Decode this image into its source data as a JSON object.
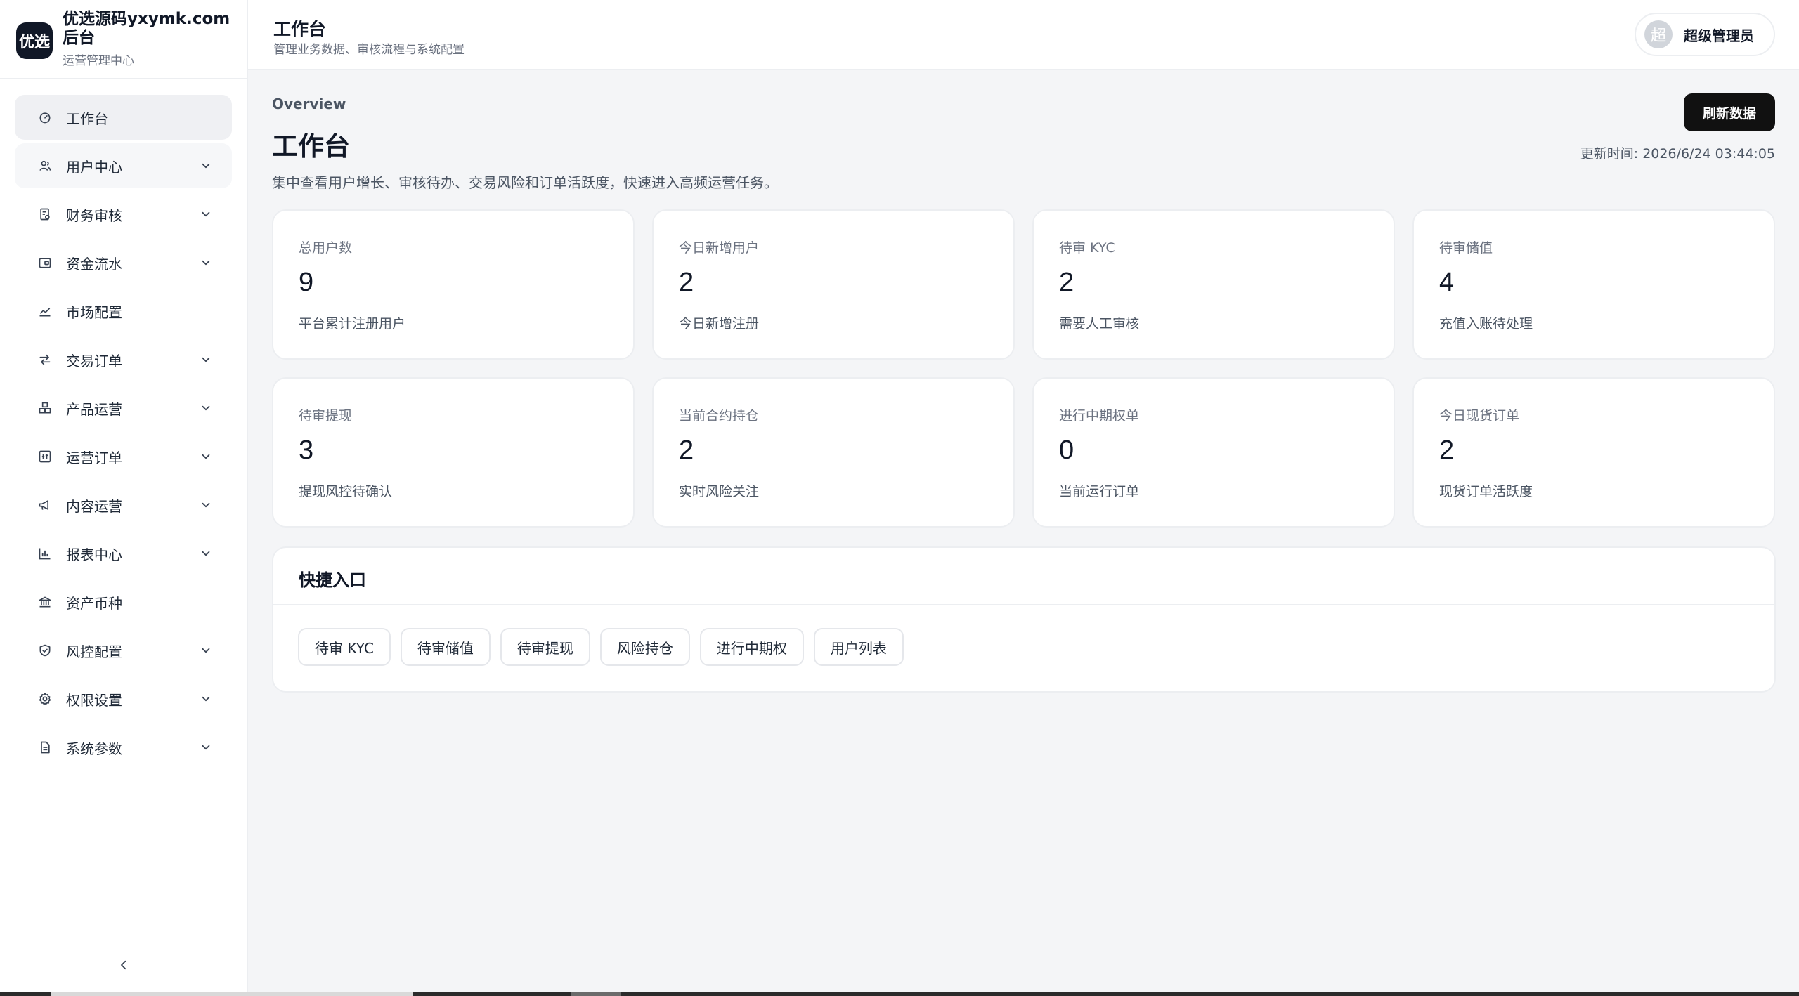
{
  "brand": {
    "logo": "优选",
    "title": "优选源码yxymk.com后台",
    "subtitle": "运营管理中心"
  },
  "sidebar": {
    "items": [
      {
        "label": "工作台",
        "icon": "dashboard-icon",
        "expandable": false,
        "active": true
      },
      {
        "label": "用户中心",
        "icon": "users-icon",
        "expandable": true,
        "active": false
      },
      {
        "label": "财务审核",
        "icon": "finance-audit-icon",
        "expandable": true,
        "active": false
      },
      {
        "label": "资金流水",
        "icon": "wallet-icon",
        "expandable": true,
        "active": false
      },
      {
        "label": "市场配置",
        "icon": "chart-line-icon",
        "expandable": false,
        "active": false
      },
      {
        "label": "交易订单",
        "icon": "exchange-icon",
        "expandable": true,
        "active": false
      },
      {
        "label": "产品运营",
        "icon": "boxes-icon",
        "expandable": true,
        "active": false
      },
      {
        "label": "运营订单",
        "icon": "grid-box-icon",
        "expandable": true,
        "active": false
      },
      {
        "label": "内容运营",
        "icon": "megaphone-icon",
        "expandable": true,
        "active": false
      },
      {
        "label": "报表中心",
        "icon": "bar-chart-icon",
        "expandable": true,
        "active": false
      },
      {
        "label": "资产币种",
        "icon": "bank-icon",
        "expandable": false,
        "active": false
      },
      {
        "label": "风控配置",
        "icon": "shield-icon",
        "expandable": true,
        "active": false
      },
      {
        "label": "权限设置",
        "icon": "gear-icon",
        "expandable": true,
        "active": false
      },
      {
        "label": "系统参数",
        "icon": "document-icon",
        "expandable": true,
        "active": false
      }
    ],
    "collapse_icon": "chevron-left-icon"
  },
  "topbar": {
    "title": "工作台",
    "subtitle": "管理业务数据、审核流程与系统配置",
    "user": {
      "avatar_text": "超",
      "name": "超级管理员"
    }
  },
  "main": {
    "overline": "Overview",
    "title": "工作台",
    "description": "集中查看用户增长、审核待办、交易风险和订单活跃度，快速进入高频运营任务。",
    "refresh_label": "刷新数据",
    "updated_label": "更新时间:",
    "updated_time": "2026/6/24 03:44:05",
    "stats": [
      {
        "label": "总用户数",
        "value": "9",
        "note": "平台累计注册用户"
      },
      {
        "label": "今日新增用户",
        "value": "2",
        "note": "今日新增注册"
      },
      {
        "label": "待审 KYC",
        "value": "2",
        "note": "需要人工审核"
      },
      {
        "label": "待审储值",
        "value": "4",
        "note": "充值入账待处理"
      },
      {
        "label": "待审提现",
        "value": "3",
        "note": "提现风控待确认"
      },
      {
        "label": "当前合约持仓",
        "value": "2",
        "note": "实时风险关注"
      },
      {
        "label": "进行中期权单",
        "value": "0",
        "note": "当前运行订单"
      },
      {
        "label": "今日现货订单",
        "value": "2",
        "note": "现货订单活跃度"
      }
    ],
    "quick": {
      "title": "快捷入口",
      "links": [
        "待审 KYC",
        "待审储值",
        "待审提现",
        "风险持仓",
        "进行中期权",
        "用户列表"
      ]
    }
  }
}
